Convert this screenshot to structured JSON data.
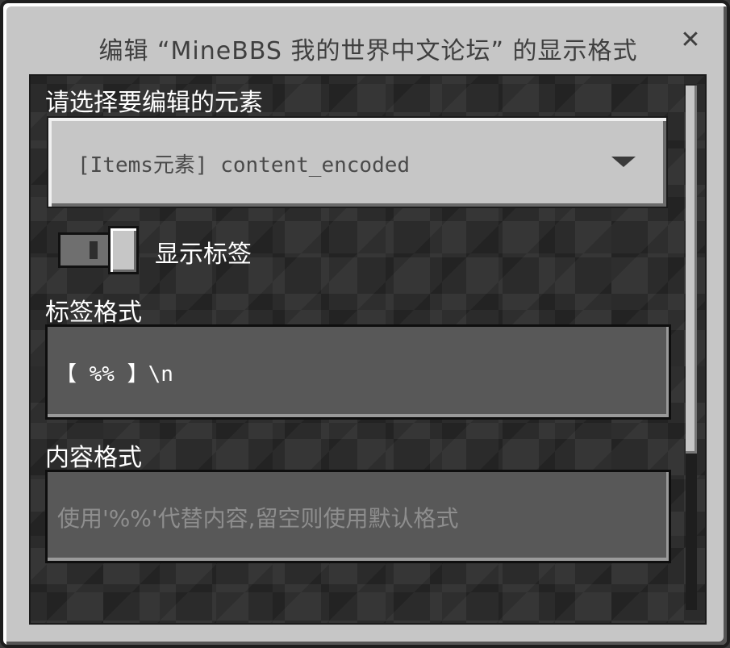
{
  "window": {
    "title": "编辑 “MineBBS 我的世界中文论坛” 的显示格式",
    "close_icon": "close-icon",
    "close_glyph": "✕"
  },
  "element_select": {
    "label": "请选择要编辑的元素",
    "selected_value": "[Items元素] content_encoded",
    "arrow_icon": "chevron-down-icon"
  },
  "show_label_toggle": {
    "label": "显示标签",
    "enabled": true
  },
  "label_format": {
    "label": "标签格式",
    "value": "【 %% 】\\n"
  },
  "content_format": {
    "label": "内容格式",
    "value": "",
    "placeholder": "使用'%%'代替内容,留空则使用默认格式"
  },
  "colors": {
    "panel_bg": "#c6c6c6",
    "field_bg": "#585858",
    "text_white": "#ffffff",
    "title_text": "#3f3f3f"
  }
}
